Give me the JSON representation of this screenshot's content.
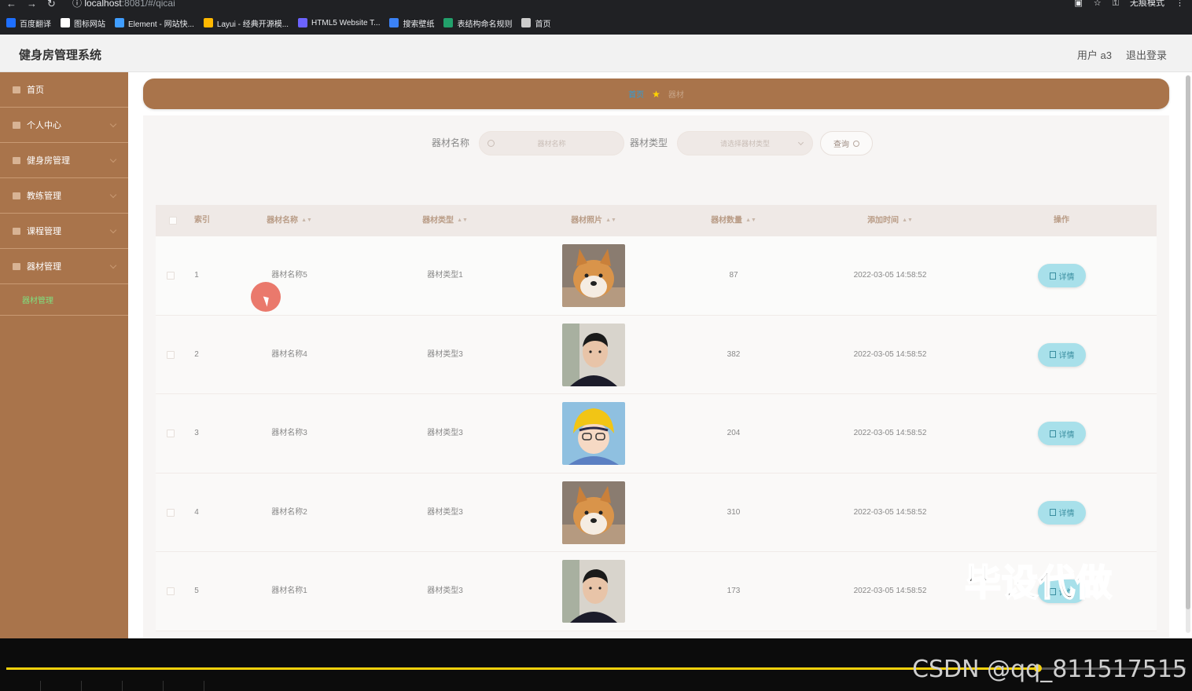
{
  "browser": {
    "url_host": "localhost",
    "url_path": ":8081/#/qicai",
    "incognito": "无痕模式",
    "bookmarks": [
      {
        "label": "百度翻译",
        "color": "#1e6fff"
      },
      {
        "label": "图标网站",
        "color": "#ffffff"
      },
      {
        "label": "Element - 网站快...",
        "color": "#409eff"
      },
      {
        "label": "Layui - 经典开源模...",
        "color": "#ffb800"
      },
      {
        "label": "HTML5 Website T...",
        "color": "#6c63ff"
      },
      {
        "label": "搜索壁纸",
        "color": "#3b82f6"
      },
      {
        "label": "表结构命名规则",
        "color": "#22a06b"
      },
      {
        "label": "首页",
        "color": "#cccccc"
      }
    ]
  },
  "header": {
    "title": "健身房管理系统",
    "user": "用户 a3",
    "logout": "退出登录"
  },
  "sidebar": {
    "items": [
      {
        "label": "首页"
      },
      {
        "label": "个人中心"
      },
      {
        "label": "健身房管理"
      },
      {
        "label": "教练管理"
      },
      {
        "label": "课程管理"
      },
      {
        "label": "器材管理"
      }
    ],
    "sub_item": "器材管理"
  },
  "breadcrumb": {
    "home": "首页",
    "current": "器材"
  },
  "search": {
    "name_label": "器材名称",
    "name_placeholder": "器材名称",
    "type_label": "器材类型",
    "type_placeholder": "请选择器材类型",
    "query_button": "查询"
  },
  "table": {
    "headers": {
      "index": "索引",
      "name": "器材名称",
      "type": "器材类型",
      "photo": "器材照片",
      "quantity": "器材数量",
      "added": "添加时间",
      "action": "操作"
    },
    "detail_label": "详情",
    "rows": [
      {
        "index": "1",
        "name": "器材名称5",
        "type": "器材类型1",
        "photo": "shiba-dog",
        "quantity": "87",
        "added": "2022-03-05 14:58:52"
      },
      {
        "index": "2",
        "name": "器材名称4",
        "type": "器材类型3",
        "photo": "man-portrait",
        "quantity": "382",
        "added": "2022-03-05 14:58:52"
      },
      {
        "index": "3",
        "name": "器材名称3",
        "type": "器材类型3",
        "photo": "anime-boy",
        "quantity": "204",
        "added": "2022-03-05 14:58:52"
      },
      {
        "index": "4",
        "name": "器材名称2",
        "type": "器材类型3",
        "photo": "shiba-dog",
        "quantity": "310",
        "added": "2022-03-05 14:58:52"
      },
      {
        "index": "5",
        "name": "器材名称1",
        "type": "器材类型3",
        "photo": "man-portrait",
        "quantity": "173",
        "added": "2022-03-05 14:58:52"
      }
    ]
  },
  "overlay": {
    "watermark": "毕设代做",
    "csdn": "CSDN @qq_811517515"
  },
  "video": {
    "progress": 0.88
  }
}
